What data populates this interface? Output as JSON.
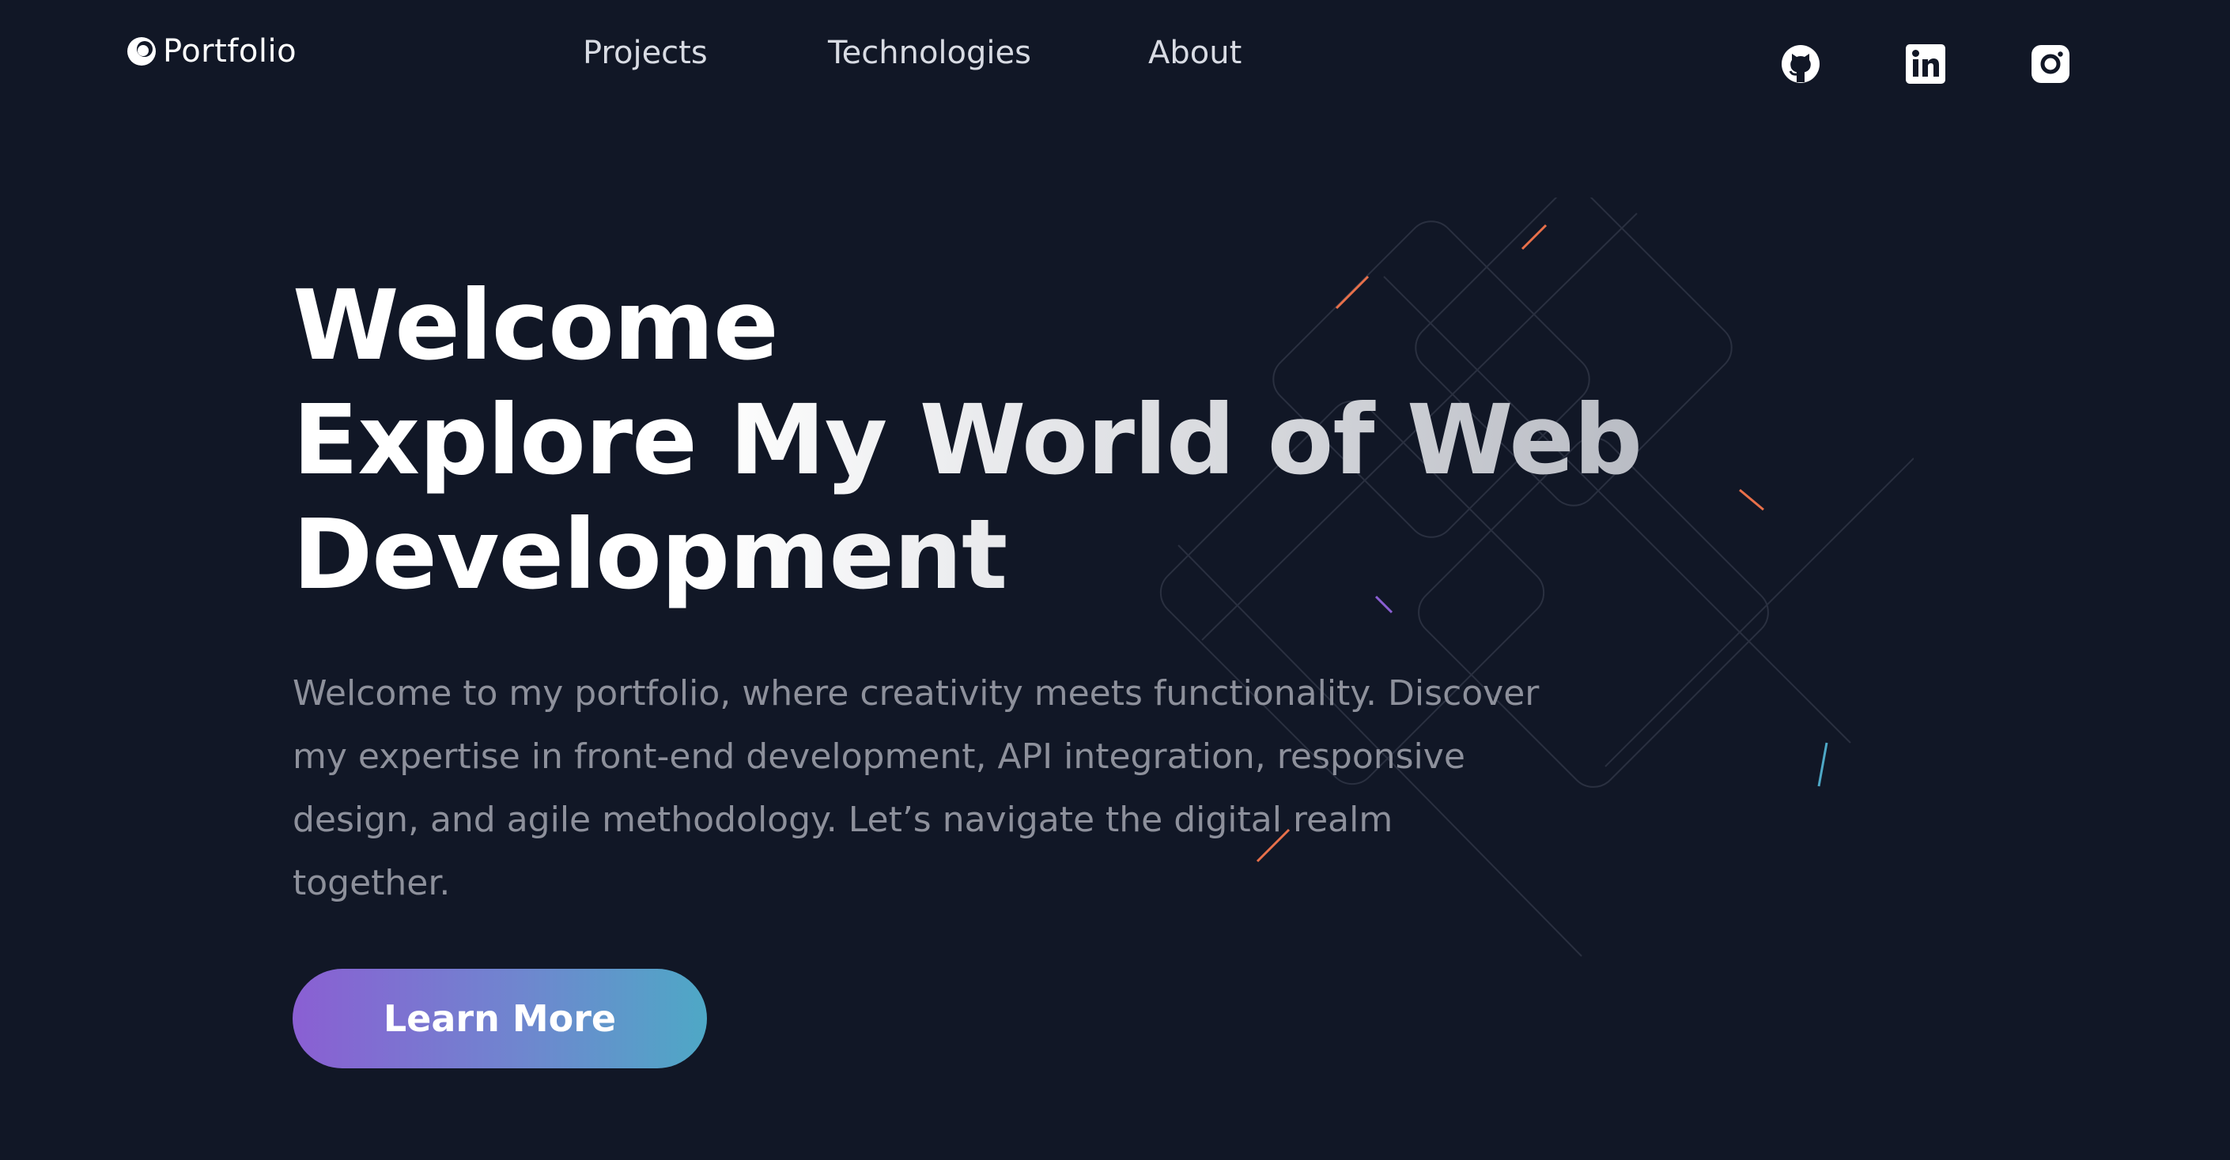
{
  "brand": {
    "name": "Portfolio",
    "icon": "logo-icon"
  },
  "nav": {
    "links": [
      {
        "label": "Projects"
      },
      {
        "label": "Technologies"
      },
      {
        "label": "About"
      }
    ],
    "social": [
      {
        "icon": "github-icon"
      },
      {
        "icon": "linkedin-icon"
      },
      {
        "icon": "instagram-icon"
      }
    ]
  },
  "hero": {
    "headline": [
      "Welcome",
      "Explore My World of Web",
      "Development"
    ],
    "intro": "Welcome to my portfolio, where creativity meets functionality. Discover my expertise in front-end development, API integration, responsive design, and agile methodology. Let’s navigate the digital realm together.",
    "cta_label": "Learn More"
  },
  "colors": {
    "background": "#111726",
    "text": "#ffffff",
    "muted_text": "#8d909b",
    "cta_gradient_start": "#8a5fd3",
    "cta_gradient_end": "#4ea8c6"
  }
}
